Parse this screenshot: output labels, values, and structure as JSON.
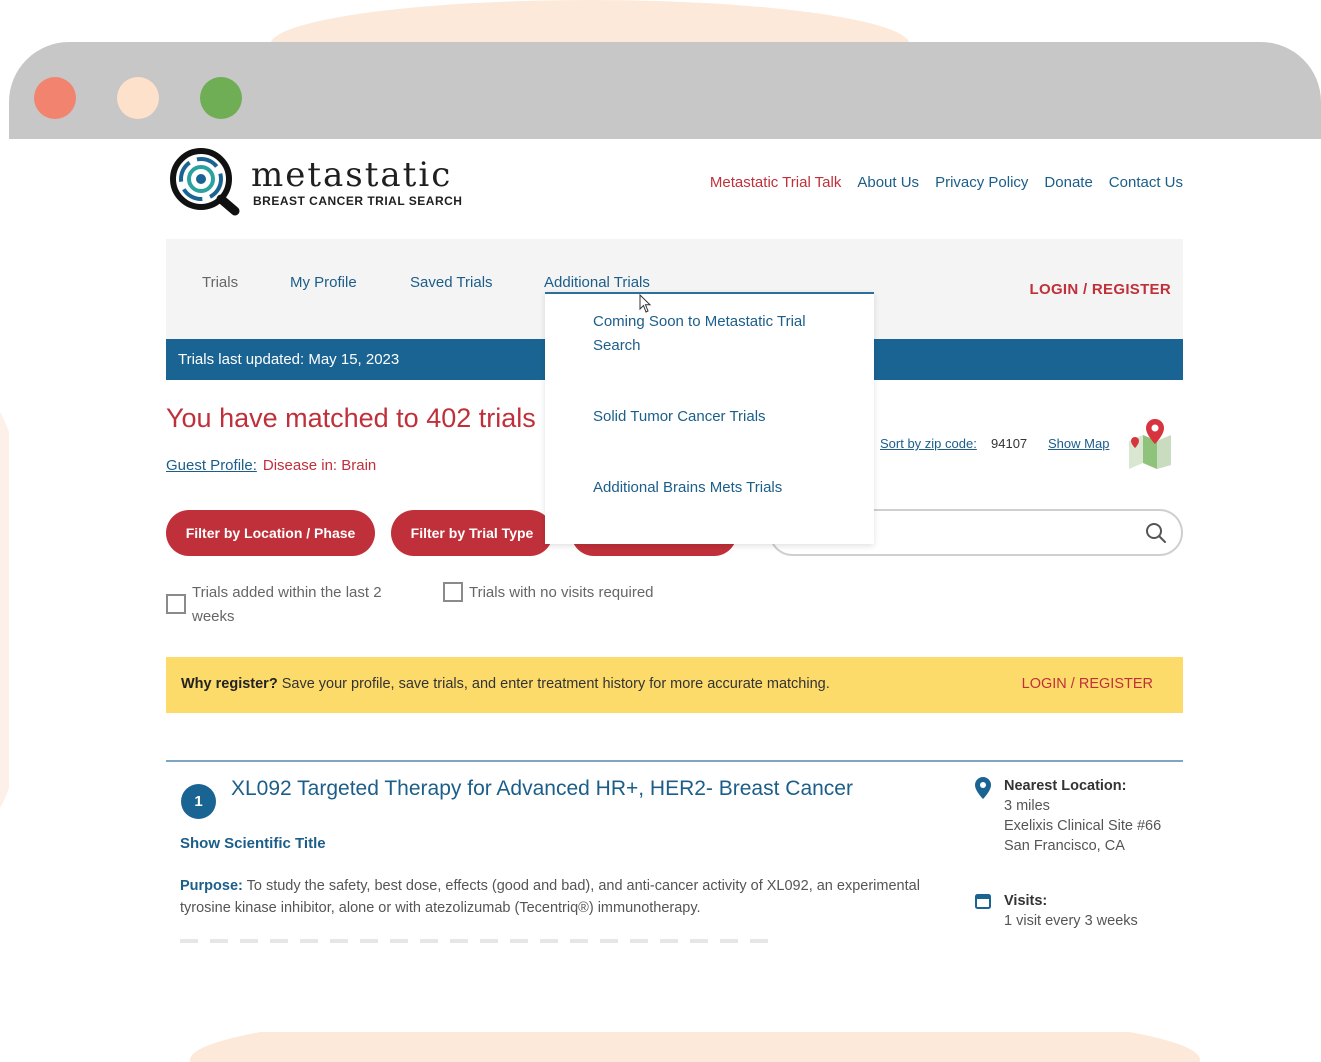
{
  "window": {
    "controls": {
      "close_color": "#f2836f",
      "minimize_color": "#fde1cb",
      "maximize_color": "#6fae55"
    }
  },
  "brand": {
    "title": "metastatic",
    "subtitle": "BREAST CANCER TRIAL SEARCH"
  },
  "topnav": {
    "items": [
      "Metastatic Trial Talk",
      "About Us",
      "Privacy Policy",
      "Donate",
      "Contact Us"
    ]
  },
  "mainnav": {
    "items": [
      "Trials",
      "My Profile",
      "Saved Trials",
      "Additional Trials"
    ],
    "login": "LOGIN / REGISTER"
  },
  "dropdown": {
    "items": [
      "Coming Soon to Metastatic Trial Search",
      "Solid Tumor Cancer Trials",
      "Additional Brains Mets Trials"
    ]
  },
  "banner": {
    "updated": "Trials last updated: May 15, 2023"
  },
  "results": {
    "matched": "You have matched to 402 trials",
    "profile_link": "Guest Profile:",
    "profile_value": "Disease in: Brain",
    "sort_label": "Sort by zip code:",
    "zip": "94107",
    "show_map": "Show Map"
  },
  "filters": {
    "location_phase": "Filter by Location / Phase",
    "trial_type": "Filter by Trial Type",
    "third": "",
    "search_placeholder": ""
  },
  "checkboxes": {
    "recent_line1": "Trials added within the last 2",
    "recent_line2": "weeks",
    "no_visits": "Trials with no visits required"
  },
  "register_bar": {
    "bold": "Why register?",
    "text": " Save your profile, save trials, and enter treatment history for more accurate matching.",
    "login": "LOGIN / REGISTER"
  },
  "trial": {
    "number": "1",
    "title": "XL092 Targeted Therapy for Advanced HR+, HER2- Breast Cancer",
    "show_scientific": "Show Scientific Title",
    "purpose_label": "Purpose:",
    "purpose_text": " To study the safety, best dose, effects (good and bad), and anti-cancer activity of XL092, an experimental tyrosine kinase inhibitor, alone or with atezolizumab (Tecentriq®) immunotherapy.",
    "nearest_label": "Nearest Location:",
    "distance": "3 miles",
    "site": "Exelixis Clinical Site #66",
    "city": "San Francisco, CA",
    "visits_label": "Visits:",
    "visits": "1 visit every 3 weeks"
  },
  "colors": {
    "brand_blue": "#1a6493",
    "brand_red": "#c0303a",
    "register_yellow": "#fddb6b"
  }
}
